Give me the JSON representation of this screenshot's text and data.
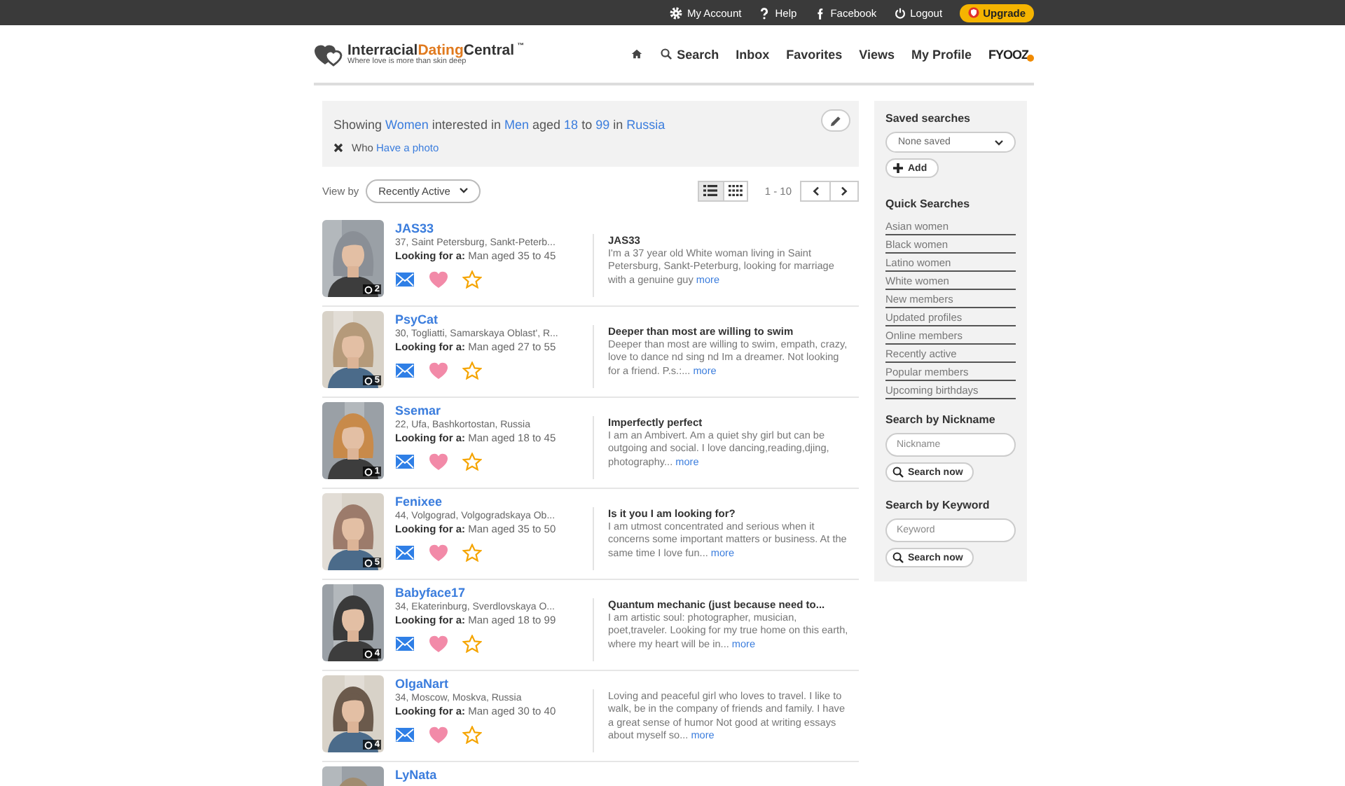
{
  "topbar": {
    "links": [
      {
        "kind": "gear",
        "label": "My Account"
      },
      {
        "kind": "question",
        "label": "Help"
      },
      {
        "kind": "facebook",
        "label": "Facebook"
      },
      {
        "kind": "power",
        "label": "Logout"
      }
    ],
    "upgrade": "Upgrade"
  },
  "logo": {
    "words": [
      {
        "text": "Interracial",
        "accent": false
      },
      {
        "text": "Dating",
        "accent": true
      },
      {
        "text": "Central",
        "accent": false
      }
    ],
    "tm": "™",
    "tagline": "Where love is more than skin deep"
  },
  "nav": [
    {
      "kind": "home"
    },
    {
      "kind": "search",
      "label": "Search"
    },
    {
      "kind": "text",
      "label": "Inbox"
    },
    {
      "kind": "text",
      "label": "Favorites"
    },
    {
      "kind": "text",
      "label": "Views"
    },
    {
      "kind": "text",
      "label": "My Profile"
    },
    {
      "kind": "brand",
      "label": "FYOOZ"
    }
  ],
  "filter": {
    "parts": [
      {
        "text": "Showing",
        "link": false
      },
      {
        "text": "Women",
        "link": true
      },
      {
        "text": "interested in",
        "link": false
      },
      {
        "text": "Men",
        "link": true
      },
      {
        "text": "aged",
        "link": false
      },
      {
        "text": "18",
        "link": true
      },
      {
        "text": "to",
        "link": false
      },
      {
        "text": "99",
        "link": true
      },
      {
        "text": "in",
        "link": false
      },
      {
        "text": "Russia",
        "link": true
      }
    ],
    "who_label": "Who",
    "who_value": "Have a photo"
  },
  "view_by": {
    "label": "View by",
    "value": "Recently Active"
  },
  "view_modes": [
    {
      "kind": "list",
      "selected": true
    },
    {
      "kind": "grid",
      "selected": false
    }
  ],
  "range": "1 - 10",
  "profiles": [
    {
      "name": "JAS33",
      "location": "37, Saint Petersburg, Sankt-Peterb...",
      "looking_label": "Looking for a:",
      "looking": "Man aged 35 to 45",
      "photos": "2",
      "title": "JAS33",
      "text": "I'm a 37 year old White woman living in Saint Petersburg, Sankt-Peterburg, looking for marriage with a genuine guy",
      "more": "more"
    },
    {
      "name": "PsyCat",
      "location": "30, Togliatti, Samarskaya Oblast', R...",
      "looking_label": "Looking for a:",
      "looking": "Man aged 27 to 55",
      "photos": "5",
      "title": "Deeper than most are willing to swim",
      "text": "Deeper than most are willing to swim, empath, crazy, love to dance nd sing nd Im a dreamer. Not looking for a friend.  P.s.:...",
      "more": "more"
    },
    {
      "name": "Ssemar",
      "location": "22, Ufa, Bashkortostan, Russia",
      "looking_label": "Looking for a:",
      "looking": "Man aged 18 to 45",
      "photos": "1",
      "title": "Imperfectly perfect",
      "text": "I am an Ambivert. Am a quiet shy girl but can be outgoing and social. I love dancing,reading,djing, photography...",
      "more": "more"
    },
    {
      "name": "Fenixee",
      "location": "44, Volgograd, Volgogradskaya Ob...",
      "looking_label": "Looking for a:",
      "looking": "Man aged 35 to 50",
      "photos": "5",
      "title": "Is it you I am looking for?",
      "text": "I am utmost concentrated and serious when it concerns some important matters or business. At the same time I love fun...",
      "more": "more"
    },
    {
      "name": "Babyface17",
      "location": "34, Ekaterinburg, Sverdlovskaya O...",
      "looking_label": "Looking for a:",
      "looking": "Man aged 18 to 99",
      "photos": "4",
      "title": "Quantum mechanic (just because need to...",
      "text": "I am artistic soul: photographer, musician, poet,traveler. Looking for my true home on this earth, where my heart will be in...",
      "more": "more"
    },
    {
      "name": "OlgaNart",
      "location": "34, Moscow, Moskva, Russia",
      "looking_label": "Looking for a:",
      "looking": "Man aged 30 to 40",
      "photos": "4",
      "text": "Loving and peaceful girl who loves to travel. I like to walk, be in the company of friends and family. I have a great sense of humor Not good at writing essays about myself so...",
      "more": "more"
    },
    {
      "name": "LyNata"
    }
  ],
  "sidebar": {
    "saved_title": "Saved searches",
    "saved_value": "None saved",
    "add": "Add",
    "quick_title": "Quick Searches",
    "quick": [
      "Asian women",
      "Black women",
      "Latino women",
      "White women",
      "New members",
      "Updated profiles",
      "Online members",
      "Recently active",
      "Popular members",
      "Upcoming birthdays"
    ],
    "nick_title": "Search by Nickname",
    "nick_placeholder": "Nickname",
    "nick_button": "Search now",
    "kw_title": "Search by Keyword",
    "kw_placeholder": "Keyword",
    "kw_button": "Search now"
  }
}
